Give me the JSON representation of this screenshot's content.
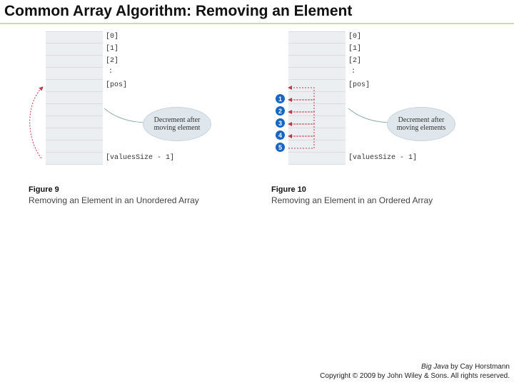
{
  "title": "Common Array Algorithm: Removing an Element",
  "accent_underline": "#c6e29b",
  "index_labels": [
    "[0]",
    "[1]",
    "[2]",
    ":",
    "[pos]",
    "[valuesSize - 1]"
  ],
  "fig9": {
    "label": "Figure 9",
    "caption": "Removing an Element in an Unordered Array",
    "callout": "Decrement after moving element"
  },
  "fig10": {
    "label": "Figure 10",
    "caption": "Removing an Element in an Ordered Array",
    "callout": "Decrement after moving elements",
    "steps": [
      "1",
      "2",
      "3",
      "4",
      "5"
    ]
  },
  "footer": {
    "book": "Big Java",
    "author": " by Cay Horstmann",
    "copyright": "Copyright © 2009 by John Wiley & Sons. All rights reserved."
  }
}
